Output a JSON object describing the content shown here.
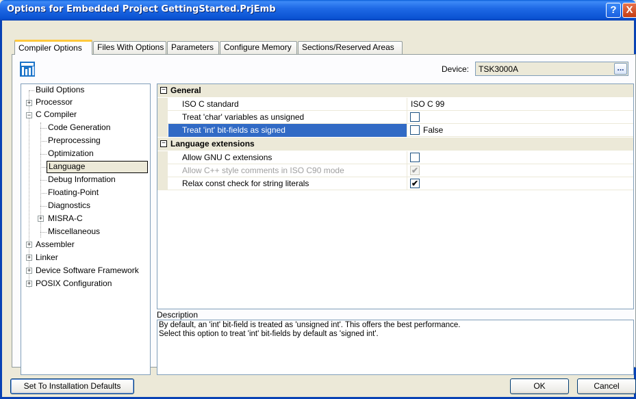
{
  "window": {
    "title": "Options for Embedded Project GettingStarted.PrjEmb",
    "help_glyph": "?",
    "close_glyph": "X"
  },
  "tabs": [
    {
      "label": "Compiler Options",
      "active": true
    },
    {
      "label": "Files With Options",
      "active": false
    },
    {
      "label": "Parameters",
      "active": false
    },
    {
      "label": "Configure Memory",
      "active": false
    },
    {
      "label": "Sections/Reserved Areas",
      "active": false
    }
  ],
  "device": {
    "label": "Device:",
    "value": "TSK3000A",
    "browse_label": "..."
  },
  "tree": {
    "items": [
      {
        "label": "Build Options",
        "expander": ""
      },
      {
        "label": "Processor",
        "expander": "+"
      },
      {
        "label": "C Compiler",
        "expander": "−"
      },
      {
        "label": "Code Generation",
        "expander": ""
      },
      {
        "label": "Preprocessing",
        "expander": ""
      },
      {
        "label": "Optimization",
        "expander": ""
      },
      {
        "label": "Language",
        "expander": "",
        "selected": true
      },
      {
        "label": "Debug Information",
        "expander": ""
      },
      {
        "label": "Floating-Point",
        "expander": ""
      },
      {
        "label": "Diagnostics",
        "expander": ""
      },
      {
        "label": "MISRA-C",
        "expander": "+"
      },
      {
        "label": "Miscellaneous",
        "expander": ""
      },
      {
        "label": "Assembler",
        "expander": "+"
      },
      {
        "label": "Linker",
        "expander": "+"
      },
      {
        "label": "Device Software Framework",
        "expander": "+"
      },
      {
        "label": "POSIX Configuration",
        "expander": "+"
      }
    ]
  },
  "grid": {
    "categories": [
      {
        "label": "General",
        "toggle": "−",
        "properties": [
          {
            "name": "ISO C standard",
            "value_text": "ISO C 99",
            "type": "text"
          },
          {
            "name": "Treat 'char' variables as unsigned",
            "checked": false,
            "type": "check"
          },
          {
            "name": "Treat 'int' bit-fields as signed",
            "checked": false,
            "value_text": "False",
            "type": "check",
            "selected": true
          }
        ]
      },
      {
        "label": "Language extensions",
        "toggle": "−",
        "properties": [
          {
            "name": "Allow GNU C extensions",
            "checked": false,
            "type": "check"
          },
          {
            "name": "Allow C++ style comments in ISO C90 mode",
            "checked": true,
            "type": "check",
            "disabled": true
          },
          {
            "name": "Relax const check for string literals",
            "checked": true,
            "type": "check"
          }
        ]
      }
    ]
  },
  "description": {
    "title": "Description",
    "line1": "By default, an 'int' bit-field is treated as 'unsigned int'. This offers the best performance.",
    "line2": "Select this option to treat 'int' bit-fields by default as 'signed int'."
  },
  "buttons": {
    "defaults": "Set To Installation Defaults",
    "ok": "OK",
    "cancel": "Cancel"
  },
  "check_glyph": "✔"
}
